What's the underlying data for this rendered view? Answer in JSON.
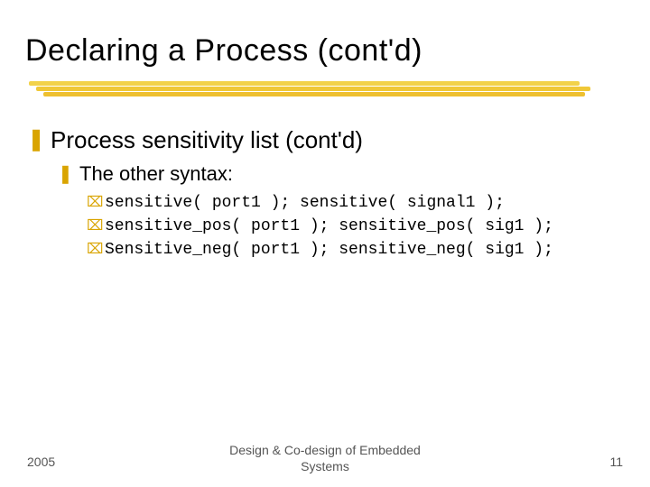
{
  "title": "Declaring a Process (cont'd)",
  "body": {
    "lvl1": {
      "text": "Process sensitivity list (cont'd)"
    },
    "lvl2": {
      "text": "The other syntax:"
    },
    "lvl3": [
      "sensitive( port1 ); sensitive( signal1 );",
      "sensitive_pos( port1 ); sensitive_pos( sig1 );",
      "Sensitive_neg( port1 ); sensitive_neg( sig1 );"
    ]
  },
  "bullets": {
    "z": "❚",
    "y": "❚",
    "x": "⌧"
  },
  "footer": {
    "left": "2005",
    "center_line1": "Design & Co-design of Embedded",
    "center_line2": "Systems",
    "right": "11"
  }
}
